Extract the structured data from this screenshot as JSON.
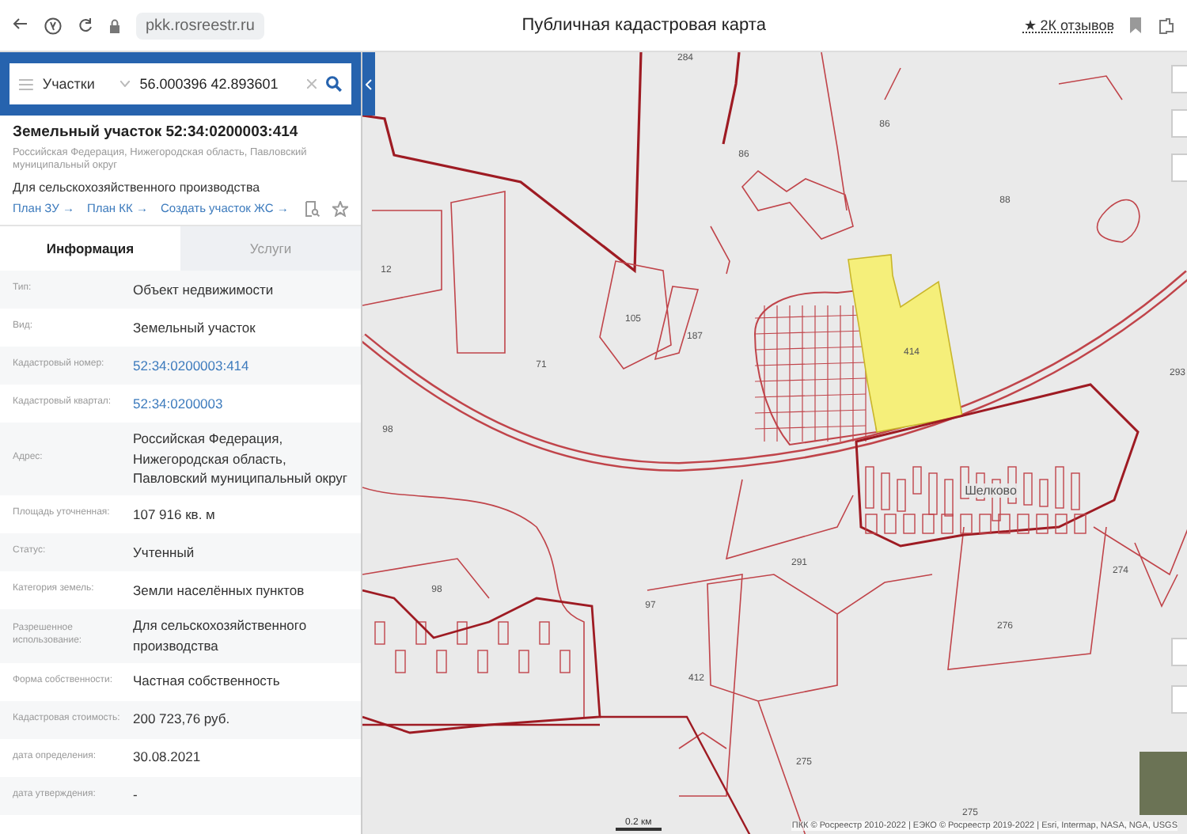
{
  "browser": {
    "url": "pkk.rosreestr.ru",
    "title": "Публичная кадастровая карта",
    "reviews": "★ 2К отзывов"
  },
  "search": {
    "layer": "Участки",
    "query": "56.000396 42.893601"
  },
  "parcel": {
    "title": "Земельный участок 52:34:0200003:414",
    "address": "Российская Федерация, Нижегородская область, Павловский муниципальный округ",
    "purpose": "Для сельскохозяйственного производства",
    "links": [
      "План ЗУ →",
      "План КК →",
      "Создать участок ЖС →"
    ]
  },
  "tabs": [
    {
      "label": "Информация",
      "selected": true
    },
    {
      "label": "Услуги",
      "selected": false
    }
  ],
  "rows": [
    {
      "label": "Тип:",
      "value": "Объект недвижимости",
      "kind": "text"
    },
    {
      "label": "Вид:",
      "value": "Земельный участок",
      "kind": "text"
    },
    {
      "label": "Кадастровый номер:",
      "value": "52:34:0200003:414",
      "kind": "link"
    },
    {
      "label": "Кадастровый квартал:",
      "value": "52:34:0200003",
      "kind": "link"
    },
    {
      "label": "Адрес:",
      "value": "Российская Федерация, Нижегородская область, Павловский муниципальный округ",
      "kind": "text"
    },
    {
      "label": "Площадь уточненная:",
      "value": "107 916 кв. м",
      "kind": "text"
    },
    {
      "label": "Статус:",
      "value": "Учтенный",
      "kind": "text"
    },
    {
      "label": "Категория земель:",
      "value": "Земли населённых пунктов",
      "kind": "text"
    },
    {
      "label": "Разрешенное использование:",
      "value": "Для сельскохозяйственного производства",
      "kind": "text"
    },
    {
      "label": "Форма собственности:",
      "value": "Частная собственность",
      "kind": "text"
    },
    {
      "label": "Кадастровая стоимость:",
      "value": "200 723,76 руб.",
      "kind": "text"
    },
    {
      "label": "дата определения:",
      "value": "30.08.2021",
      "kind": "text"
    },
    {
      "label": "дата утверждения:",
      "value": "-",
      "kind": "text"
    }
  ],
  "map": {
    "labels": [
      "284",
      "86",
      "86",
      "88",
      "12",
      "105",
      "187",
      "71",
      "414",
      "293",
      "98",
      "Шелково",
      "291",
      "274",
      "98",
      "97",
      "276",
      "412",
      "275",
      "275"
    ],
    "scale": "0.2 км",
    "attribution": "ПКК © Росреестр 2010-2022 | ЕЭКО © Росреестр 2019-2022 | Esri, Intermap, NASA, NGA, USGS"
  }
}
